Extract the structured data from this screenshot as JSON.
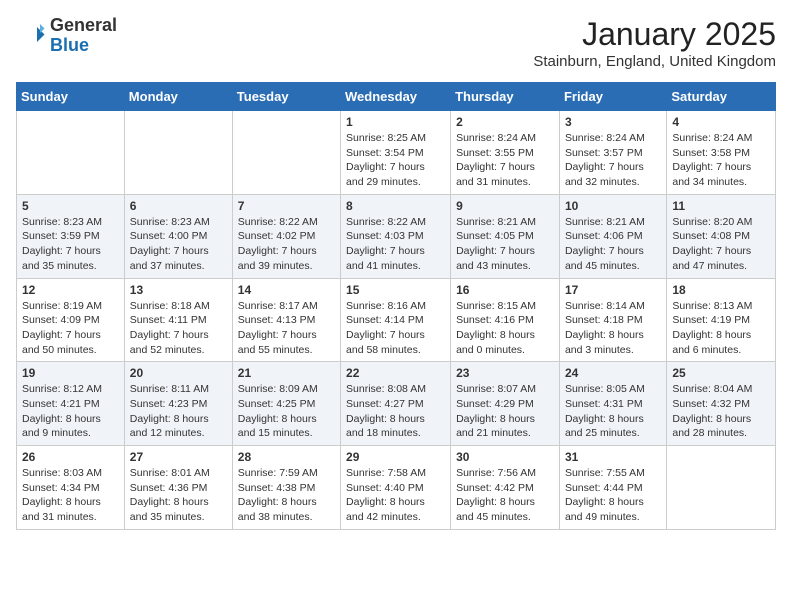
{
  "header": {
    "logo_general": "General",
    "logo_blue": "Blue",
    "month_title": "January 2025",
    "location": "Stainburn, England, United Kingdom"
  },
  "weekdays": [
    "Sunday",
    "Monday",
    "Tuesday",
    "Wednesday",
    "Thursday",
    "Friday",
    "Saturday"
  ],
  "weeks": [
    [
      {
        "day": "",
        "content": ""
      },
      {
        "day": "",
        "content": ""
      },
      {
        "day": "",
        "content": ""
      },
      {
        "day": "1",
        "content": "Sunrise: 8:25 AM\nSunset: 3:54 PM\nDaylight: 7 hours\nand 29 minutes."
      },
      {
        "day": "2",
        "content": "Sunrise: 8:24 AM\nSunset: 3:55 PM\nDaylight: 7 hours\nand 31 minutes."
      },
      {
        "day": "3",
        "content": "Sunrise: 8:24 AM\nSunset: 3:57 PM\nDaylight: 7 hours\nand 32 minutes."
      },
      {
        "day": "4",
        "content": "Sunrise: 8:24 AM\nSunset: 3:58 PM\nDaylight: 7 hours\nand 34 minutes."
      }
    ],
    [
      {
        "day": "5",
        "content": "Sunrise: 8:23 AM\nSunset: 3:59 PM\nDaylight: 7 hours\nand 35 minutes."
      },
      {
        "day": "6",
        "content": "Sunrise: 8:23 AM\nSunset: 4:00 PM\nDaylight: 7 hours\nand 37 minutes."
      },
      {
        "day": "7",
        "content": "Sunrise: 8:22 AM\nSunset: 4:02 PM\nDaylight: 7 hours\nand 39 minutes."
      },
      {
        "day": "8",
        "content": "Sunrise: 8:22 AM\nSunset: 4:03 PM\nDaylight: 7 hours\nand 41 minutes."
      },
      {
        "day": "9",
        "content": "Sunrise: 8:21 AM\nSunset: 4:05 PM\nDaylight: 7 hours\nand 43 minutes."
      },
      {
        "day": "10",
        "content": "Sunrise: 8:21 AM\nSunset: 4:06 PM\nDaylight: 7 hours\nand 45 minutes."
      },
      {
        "day": "11",
        "content": "Sunrise: 8:20 AM\nSunset: 4:08 PM\nDaylight: 7 hours\nand 47 minutes."
      }
    ],
    [
      {
        "day": "12",
        "content": "Sunrise: 8:19 AM\nSunset: 4:09 PM\nDaylight: 7 hours\nand 50 minutes."
      },
      {
        "day": "13",
        "content": "Sunrise: 8:18 AM\nSunset: 4:11 PM\nDaylight: 7 hours\nand 52 minutes."
      },
      {
        "day": "14",
        "content": "Sunrise: 8:17 AM\nSunset: 4:13 PM\nDaylight: 7 hours\nand 55 minutes."
      },
      {
        "day": "15",
        "content": "Sunrise: 8:16 AM\nSunset: 4:14 PM\nDaylight: 7 hours\nand 58 minutes."
      },
      {
        "day": "16",
        "content": "Sunrise: 8:15 AM\nSunset: 4:16 PM\nDaylight: 8 hours\nand 0 minutes."
      },
      {
        "day": "17",
        "content": "Sunrise: 8:14 AM\nSunset: 4:18 PM\nDaylight: 8 hours\nand 3 minutes."
      },
      {
        "day": "18",
        "content": "Sunrise: 8:13 AM\nSunset: 4:19 PM\nDaylight: 8 hours\nand 6 minutes."
      }
    ],
    [
      {
        "day": "19",
        "content": "Sunrise: 8:12 AM\nSunset: 4:21 PM\nDaylight: 8 hours\nand 9 minutes."
      },
      {
        "day": "20",
        "content": "Sunrise: 8:11 AM\nSunset: 4:23 PM\nDaylight: 8 hours\nand 12 minutes."
      },
      {
        "day": "21",
        "content": "Sunrise: 8:09 AM\nSunset: 4:25 PM\nDaylight: 8 hours\nand 15 minutes."
      },
      {
        "day": "22",
        "content": "Sunrise: 8:08 AM\nSunset: 4:27 PM\nDaylight: 8 hours\nand 18 minutes."
      },
      {
        "day": "23",
        "content": "Sunrise: 8:07 AM\nSunset: 4:29 PM\nDaylight: 8 hours\nand 21 minutes."
      },
      {
        "day": "24",
        "content": "Sunrise: 8:05 AM\nSunset: 4:31 PM\nDaylight: 8 hours\nand 25 minutes."
      },
      {
        "day": "25",
        "content": "Sunrise: 8:04 AM\nSunset: 4:32 PM\nDaylight: 8 hours\nand 28 minutes."
      }
    ],
    [
      {
        "day": "26",
        "content": "Sunrise: 8:03 AM\nSunset: 4:34 PM\nDaylight: 8 hours\nand 31 minutes."
      },
      {
        "day": "27",
        "content": "Sunrise: 8:01 AM\nSunset: 4:36 PM\nDaylight: 8 hours\nand 35 minutes."
      },
      {
        "day": "28",
        "content": "Sunrise: 7:59 AM\nSunset: 4:38 PM\nDaylight: 8 hours\nand 38 minutes."
      },
      {
        "day": "29",
        "content": "Sunrise: 7:58 AM\nSunset: 4:40 PM\nDaylight: 8 hours\nand 42 minutes."
      },
      {
        "day": "30",
        "content": "Sunrise: 7:56 AM\nSunset: 4:42 PM\nDaylight: 8 hours\nand 45 minutes."
      },
      {
        "day": "31",
        "content": "Sunrise: 7:55 AM\nSunset: 4:44 PM\nDaylight: 8 hours\nand 49 minutes."
      },
      {
        "day": "",
        "content": ""
      }
    ]
  ]
}
